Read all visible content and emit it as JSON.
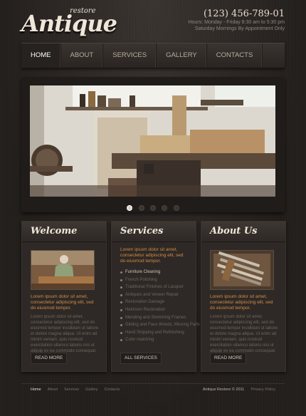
{
  "header": {
    "logo_small": "restore",
    "logo_main": "Antique",
    "phone": "(123) 456-789-01",
    "hours_line1": "Hours: Monday - Friday 8:30 am to 5:30 pm",
    "hours_line2": "Saturday Mornings By Appointment Only"
  },
  "nav": {
    "items": [
      {
        "label": "Home",
        "active": true
      },
      {
        "label": "About"
      },
      {
        "label": "Services"
      },
      {
        "label": "Gallery"
      },
      {
        "label": "Contacts"
      }
    ]
  },
  "slider": {
    "dots": 5,
    "active_dot": 1
  },
  "welcome": {
    "title": "Welcome",
    "lead": "Lorem ipsum dolor sit amet, consectetur adipiscing elit, sed do eiusmod tempor.",
    "body": "Lorem ipsum dolor sit amet, consectetur adipiscing elit, sed do eiusmod tempor incididunt ut labore et dolore magna aliqua. Ut enim ad minim veniam, quis nostrud exercitation ullamco laboris nisi ut aliquip ex ea commodo consequat.",
    "button": "Read more"
  },
  "services": {
    "title": "Services",
    "lead": "Lorem ipsum dolor sit amet, consectetur adipiscing elit, sed do eiusmod tempor.",
    "items": [
      "Furniture Cleaning",
      "French Polishing",
      "Traditional Finishes of Lacquer",
      "Antiques and Veneer Repair",
      "Restoration Damage",
      "Heirloom Restoration",
      "Mending and Stretching Frames",
      "Gilding and Faux Woods, Missing Parts",
      "Hand Stripping and Refinishing",
      "Color matching"
    ],
    "button": "All services"
  },
  "about": {
    "title": "About Us",
    "lead": "Lorem ipsum dolor sit amet, consectetur adipiscing elit, sed do eiusmod tempor.",
    "body": "Lorem ipsum dolor sit amet, consectetur adipiscing elit, sed do eiusmod tempor incididunt ut labore et dolore magna aliqua. Ut enim ad minim veniam, quis nostrud exercitation ullamco laboris nisi ut aliquip ex ea commodo consequat.",
    "button": "Read more"
  },
  "footer": {
    "links": [
      {
        "label": "Home",
        "active": true
      },
      {
        "label": "About"
      },
      {
        "label": "Services"
      },
      {
        "label": "Gallery"
      },
      {
        "label": "Contacts"
      }
    ],
    "copyright": "Antique Restore © 2011",
    "privacy": "Privacy Policy"
  },
  "colors": {
    "background": "#2b2724",
    "accent_orange": "#d28d46",
    "heading": "#f1e8dc"
  }
}
